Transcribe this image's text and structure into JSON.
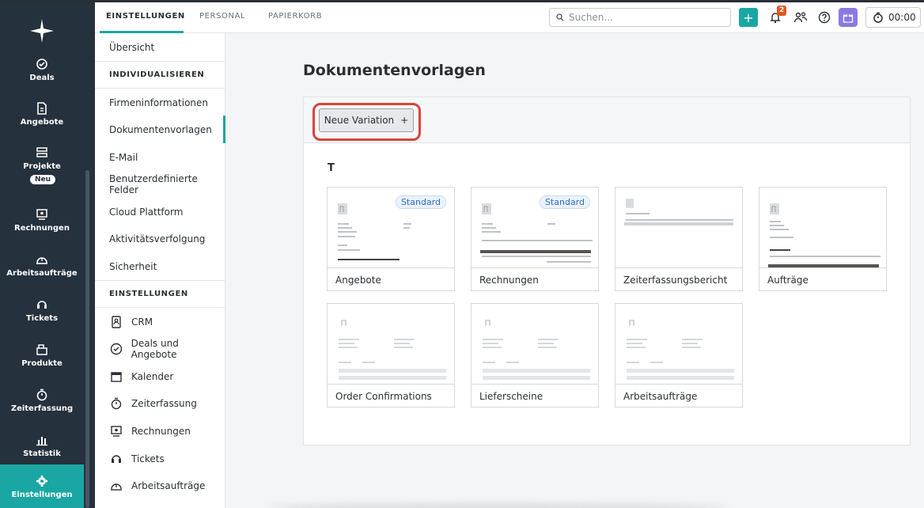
{
  "topbar": {
    "tabs": [
      "EINSTELLUNGEN",
      "PERSONAL",
      "PAPIERKORB"
    ],
    "search_placeholder": "Suchen...",
    "notification_count": "2",
    "timer": "00:00"
  },
  "leftnav": {
    "items": [
      "Deals",
      "Angebote",
      "Projekte",
      "Rechnungen",
      "Arbeitsaufträge",
      "Tickets",
      "Produkte",
      "Zeiterfassung",
      "Statistik",
      "Einstellungen"
    ],
    "new_badge": "Neu",
    "accent": "#1aa7a4"
  },
  "subnav": {
    "overview": "Übersicht",
    "section1": "INDIVIDUALISIEREN",
    "custom_items": [
      "Firmeninformationen",
      "Dokumentenvorlagen",
      "E-Mail",
      "Benutzerdefinierte Felder",
      "Cloud Plattform",
      "Aktivitätsverfolgung",
      "Sicherheit"
    ],
    "section2": "EINSTELLUNGEN",
    "settings_items": [
      "CRM",
      "Deals und Angebote",
      "Kalender",
      "Zeiterfassung",
      "Rechnungen",
      "Tickets",
      "Arbeitsaufträge"
    ]
  },
  "main": {
    "title": "Dokumentenvorlagen",
    "new_variation": "Neue Variation",
    "group_label": "T",
    "standard_label": "Standard",
    "templates": [
      "Angebote",
      "Rechnungen",
      "Zeiterfassungsbericht",
      "Aufträge",
      "Order Confirmations",
      "Lieferscheine",
      "Arbeitsaufträge"
    ],
    "highlight_color": "#d6453b"
  }
}
